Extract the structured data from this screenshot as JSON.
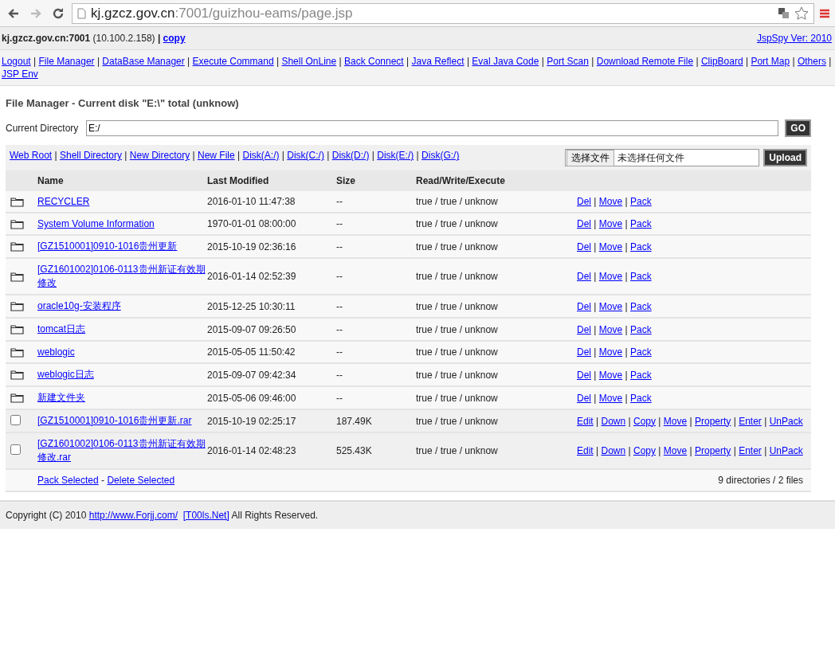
{
  "browser": {
    "url_host": "kj.gzcz.gov.cn",
    "url_rest": ":7001/guizhou-eams/page.jsp",
    "back_disabled": false,
    "forward_disabled": true
  },
  "header": {
    "host_info": "**kj.gzcz.gov.cn:7001** (10.100.2.158) **|**",
    "copy_link": "copy",
    "version_link": "JspSpy Ver: 2010"
  },
  "separator": "|",
  "nav_links": [
    "Logout",
    "File Manager",
    "DataBase Manager",
    "Execute Command",
    "Shell OnLine",
    "Back Connect",
    "Java Reflect",
    "Eval Java Code",
    "Port Scan",
    "Download Remote File",
    "ClipBoard",
    "Port Map",
    "Others",
    "JSP Env"
  ],
  "title": "File Manager - Current disk \"E:\\\" total (unknow)",
  "directory_form": {
    "label": "Current Directory",
    "value": "E:/",
    "button": "GO"
  },
  "tool_links": [
    "Web Root",
    "Shell Directory",
    "New Directory",
    "New File",
    "Disk(A:/)",
    "Disk(C:/)",
    "Disk(D:/)",
    "Disk(E:/)",
    "Disk(G:/)"
  ],
  "upload": {
    "choose_button": "选择文件",
    "status": "未选择任何文件",
    "button": "Upload"
  },
  "table": {
    "columns": [
      "Name",
      "Last Modified",
      "Size",
      "Read/Write/Execute"
    ],
    "rows": [
      {
        "kind": "directory",
        "name": "RECYCLER",
        "modified": "2016-01-10 11:47:38",
        "size": "--",
        "rwx": "true / true / unknow",
        "actions": [
          "Del",
          "Move",
          "Pack"
        ]
      },
      {
        "kind": "directory",
        "name": "System Volume Information",
        "modified": "1970-01-01 08:00:00",
        "size": "--",
        "rwx": "true / true / unknow",
        "actions": [
          "Del",
          "Move",
          "Pack"
        ]
      },
      {
        "kind": "directory",
        "name": "[GZ1510001]0910-1016贵州更新",
        "modified": "2015-10-19 02:36:16",
        "size": "--",
        "rwx": "true / true / unknow",
        "actions": [
          "Del",
          "Move",
          "Pack"
        ]
      },
      {
        "kind": "directory",
        "name": "[GZ1601002]0106-0113贵州新证有效期修改",
        "modified": "2016-01-14 02:52:39",
        "size": "--",
        "rwx": "true / true / unknow",
        "actions": [
          "Del",
          "Move",
          "Pack"
        ]
      },
      {
        "kind": "directory",
        "name": "oracle10g-安装程序",
        "modified": "2015-12-25 10:30:11",
        "size": "--",
        "rwx": "true / true / unknow",
        "actions": [
          "Del",
          "Move",
          "Pack"
        ]
      },
      {
        "kind": "directory",
        "name": "tomcat日志",
        "modified": "2015-09-07 09:26:50",
        "size": "--",
        "rwx": "true / true / unknow",
        "actions": [
          "Del",
          "Move",
          "Pack"
        ]
      },
      {
        "kind": "directory",
        "name": "weblogic",
        "modified": "2015-05-05 11:50:42",
        "size": "--",
        "rwx": "true / true / unknow",
        "actions": [
          "Del",
          "Move",
          "Pack"
        ]
      },
      {
        "kind": "directory",
        "name": "weblogic日志",
        "modified": "2015-09-07 09:42:34",
        "size": "--",
        "rwx": "true / true / unknow",
        "actions": [
          "Del",
          "Move",
          "Pack"
        ]
      },
      {
        "kind": "directory",
        "name": "新建文件夹",
        "modified": "2015-05-06 09:46:00",
        "size": "--",
        "rwx": "true / true / unknow",
        "actions": [
          "Del",
          "Move",
          "Pack"
        ]
      },
      {
        "kind": "file",
        "checked": false,
        "name": "[GZ1510001]0910-1016贵州更新.rar",
        "modified": "2015-10-19 02:25:17",
        "size": "187.49K",
        "rwx": "true / true / unknow",
        "actions": [
          "Edit",
          "Down",
          "Copy",
          "Move",
          "Property",
          "Enter",
          "UnPack"
        ]
      },
      {
        "kind": "file",
        "checked": false,
        "name": "[GZ1601002]0106-0113贵州新证有效期修改.rar",
        "modified": "2016-01-14 02:48:23",
        "size": "525.43K",
        "rwx": "true / true / unknow",
        "actions": [
          "Edit",
          "Down",
          "Copy",
          "Move",
          "Property",
          "Enter",
          "UnPack"
        ]
      }
    ],
    "footer_links": [
      "Pack Selected",
      "Delete Selected"
    ],
    "footer_separator": "-",
    "summary": "9 directories / 2 files"
  },
  "copyright": {
    "prefix": "Copyright (C) 2010",
    "site_link": "http://www.Forjj.com/",
    "team_link": "[T00ls.Net]",
    "suffix": "All Rights Reserved."
  }
}
